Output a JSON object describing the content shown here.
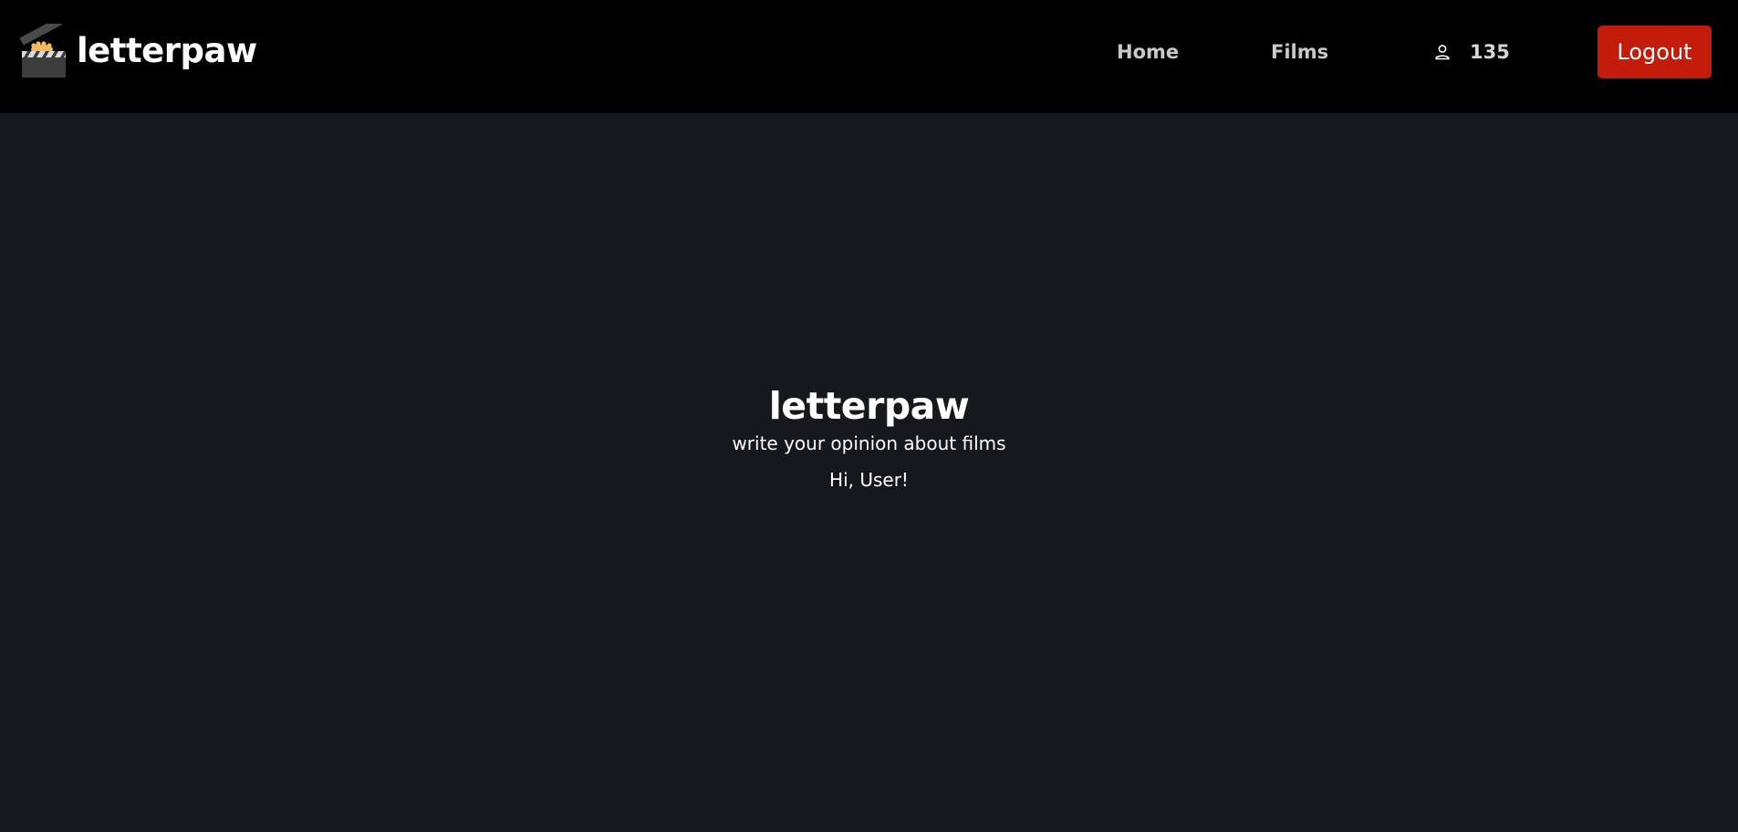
{
  "header": {
    "brand": {
      "name": "letterpaw",
      "icon": "clapperboard-icon"
    },
    "nav": {
      "home_label": "Home",
      "films_label": "Films"
    },
    "user": {
      "icon": "user-icon",
      "count": "135"
    },
    "logout_label": "Logout"
  },
  "hero": {
    "title": "letterpaw",
    "subtitle": "write your opinion about films",
    "greeting": "Hi, User!"
  },
  "colors": {
    "navbar_bg": "#000000",
    "page_bg": "#17181d",
    "logout_bg": "#c41c0b",
    "nav_text": "#c9c9c9",
    "paw_accent": "#f5b95e"
  }
}
